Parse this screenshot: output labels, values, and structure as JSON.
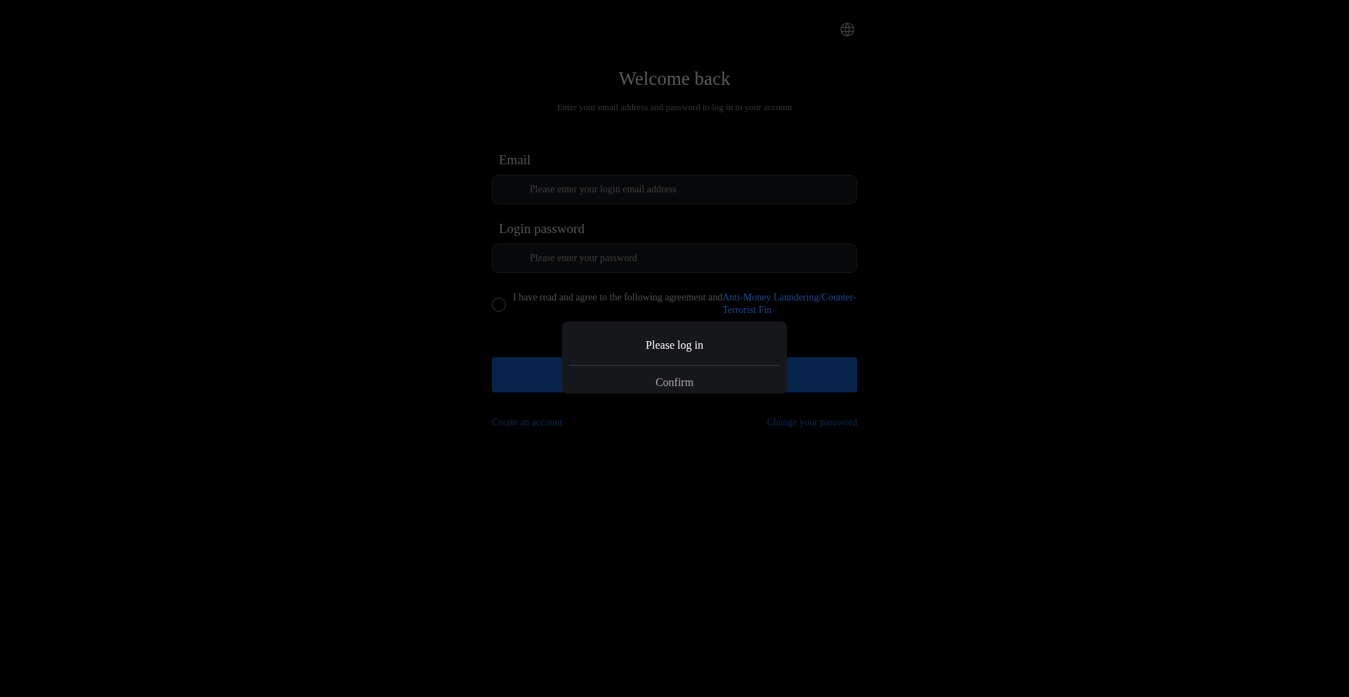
{
  "title": "Welcome back",
  "subtitle": "Enter your email address and password to log in to your account",
  "fields": [
    {
      "label": "Email",
      "placeholder": "Please enter your login email address"
    },
    {
      "label": "Login password",
      "placeholder": "Please enter your password"
    }
  ],
  "agreement": {
    "checked": false,
    "text": "I have read and agree to the following agreement and",
    "link": "Anti-Money Laundering/Counter-Terrorist Fin"
  },
  "links": [
    "Create an account",
    "Change your password"
  ],
  "dialog": {
    "message": "Please log in",
    "button": "Confirm"
  }
}
